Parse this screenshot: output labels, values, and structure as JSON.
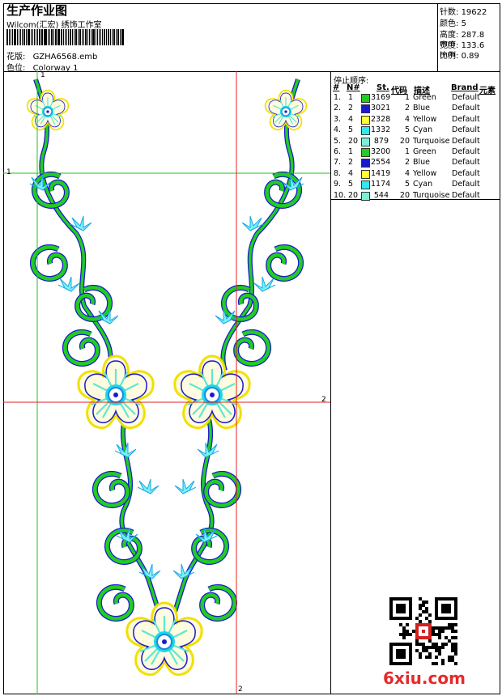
{
  "header": {
    "title": "生产作业图",
    "software": "Wilcom(汇宏) 绣饰工作室",
    "design_label": "花版:",
    "design_value": "GZHA6568.emb",
    "colorway_label": "色位:",
    "colorway_value": "Colorway 1"
  },
  "stats": [
    {
      "label": "针数:",
      "value": "19622"
    },
    {
      "label": "颜色:",
      "value": "5"
    },
    {
      "label": "高度:",
      "value": "287.8 mm"
    },
    {
      "label": "宽度:",
      "value": "133.6 mm"
    },
    {
      "label": "比例:",
      "value": "0.89"
    }
  ],
  "table": {
    "title": "停止顺序:",
    "headers": [
      "#",
      "N#",
      "St.",
      "代码",
      "描述",
      "Brand",
      "元素"
    ],
    "rows": [
      {
        "idx": "1.",
        "n": "1",
        "st": "3169",
        "code": "1",
        "desc": "Green",
        "brand": "Default",
        "color": "#22cc22"
      },
      {
        "idx": "2.",
        "n": "2",
        "st": "3021",
        "code": "2",
        "desc": "Blue",
        "brand": "Default",
        "color": "#1a1acc"
      },
      {
        "idx": "3.",
        "n": "4",
        "st": "2328",
        "code": "4",
        "desc": "Yellow",
        "brand": "Default",
        "color": "#ffff33"
      },
      {
        "idx": "4.",
        "n": "5",
        "st": "1332",
        "code": "5",
        "desc": "Cyan",
        "brand": "Default",
        "color": "#33e8f0"
      },
      {
        "idx": "5.",
        "n": "20",
        "st": "879",
        "code": "20",
        "desc": "Turquoise",
        "brand": "Default",
        "color": "#7af0d8"
      },
      {
        "idx": "6.",
        "n": "1",
        "st": "3200",
        "code": "1",
        "desc": "Green",
        "brand": "Default",
        "color": "#22cc22"
      },
      {
        "idx": "7.",
        "n": "2",
        "st": "2554",
        "code": "2",
        "desc": "Blue",
        "brand": "Default",
        "color": "#1a1acc"
      },
      {
        "idx": "8.",
        "n": "4",
        "st": "1419",
        "code": "4",
        "desc": "Yellow",
        "brand": "Default",
        "color": "#ffff33"
      },
      {
        "idx": "9.",
        "n": "5",
        "st": "1174",
        "code": "5",
        "desc": "Cyan",
        "brand": "Default",
        "color": "#33e8f0"
      },
      {
        "idx": "10.",
        "n": "20",
        "st": "544",
        "code": "20",
        "desc": "Turquoise",
        "brand": "Default",
        "color": "#7af0d8"
      }
    ]
  },
  "markers": {
    "h1": "1",
    "h2": "2",
    "v1": "1",
    "v2": "2"
  },
  "watermark": "6xiu.com"
}
